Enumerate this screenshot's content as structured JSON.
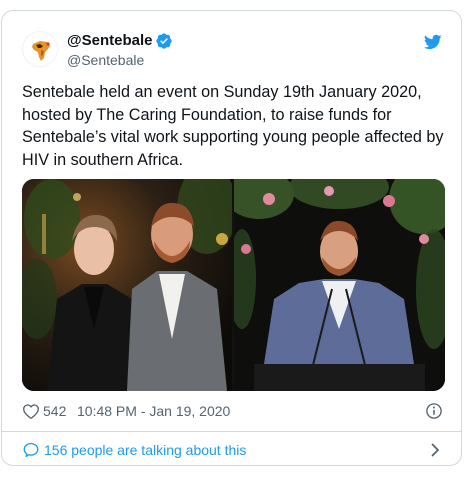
{
  "tweet": {
    "display_name": "@Sentebale",
    "handle": "@Sentebale",
    "verified": true,
    "text": "Sentebale held an event on Sunday 19th January 2020, hosted by The Caring Foundation, to raise funds for Sentebale’s vital work supporting young people affected by HIV in southern Africa.",
    "like_count": "542",
    "timestamp": "10:48 PM - Jan 19, 2020",
    "talking_label": "156 people are talking about this"
  },
  "icons": {
    "avatar": "sentebale-africa-logo",
    "verified": "verified-badge-icon",
    "platform": "twitter-bird-icon",
    "like": "heart-icon",
    "info": "info-icon",
    "reply": "chat-bubble-icon",
    "expand": "chevron-right-icon"
  },
  "colors": {
    "accent": "#1d9bf0",
    "text": "#0f1419",
    "muted": "#536471",
    "border": "#cfd9de"
  }
}
